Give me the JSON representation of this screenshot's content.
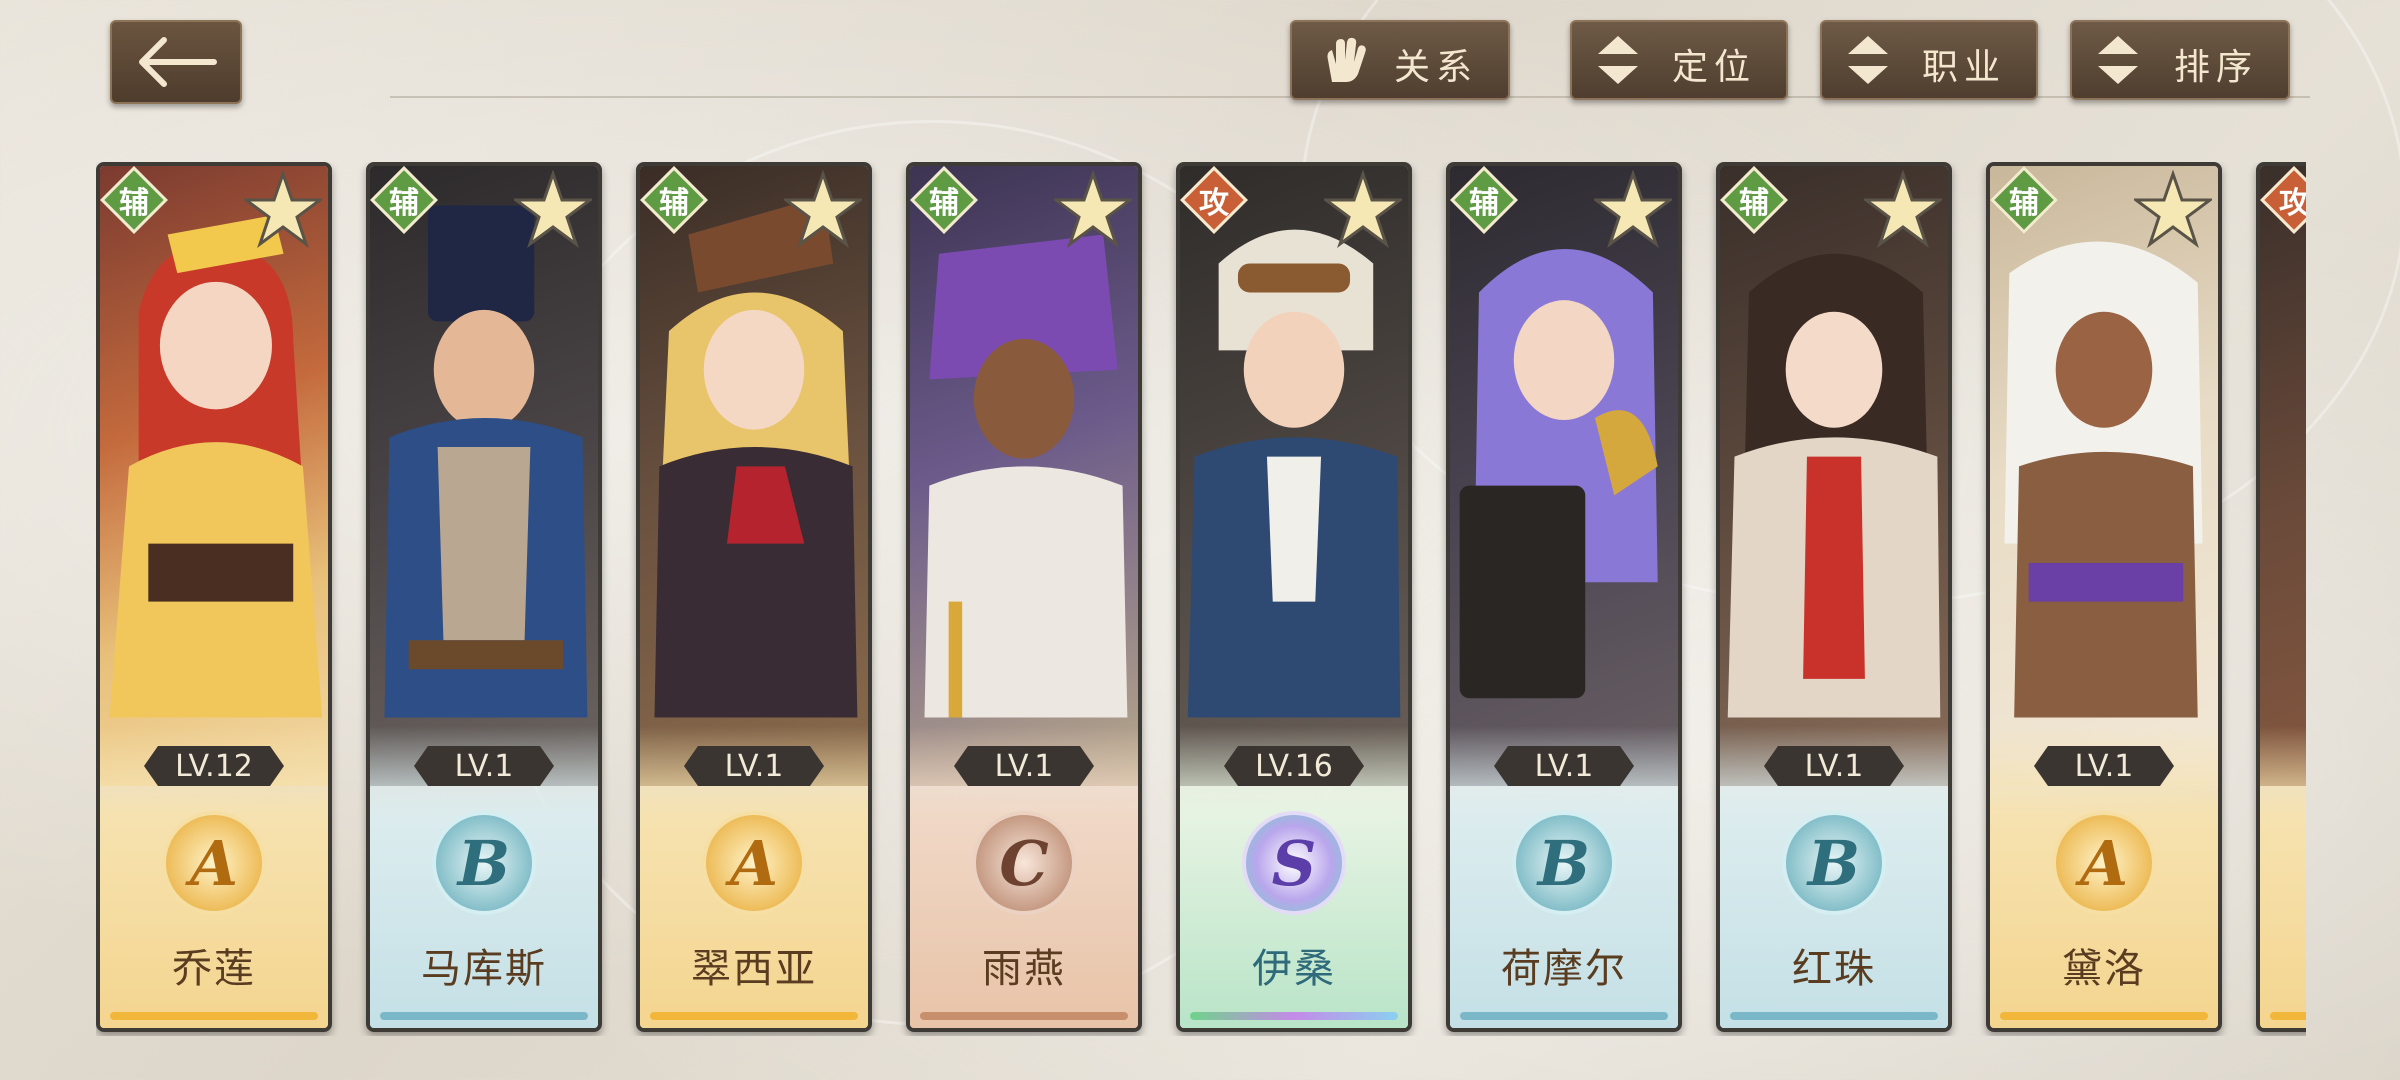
{
  "toolbar": {
    "relation_label": "关系",
    "position_label": "定位",
    "job_label": "职业",
    "sort_label": "排序"
  },
  "colors": {
    "support_tag": "#5f9b43",
    "attack_tag": "#c95f37",
    "rank_A": "#e6a52a",
    "rank_B": "#5aa7b5",
    "rank_C": "#b07a5e",
    "rank_S": "#8d6ad0"
  },
  "heroes": [
    {
      "role": "辅",
      "level": "LV.12",
      "rank": "A",
      "name": "乔莲"
    },
    {
      "role": "辅",
      "level": "LV.1",
      "rank": "B",
      "name": "马库斯"
    },
    {
      "role": "辅",
      "level": "LV.1",
      "rank": "A",
      "name": "翠西亚"
    },
    {
      "role": "辅",
      "level": "LV.1",
      "rank": "C",
      "name": "雨燕"
    },
    {
      "role": "攻",
      "level": "LV.16",
      "rank": "S",
      "name": "伊桑"
    },
    {
      "role": "辅",
      "level": "LV.1",
      "rank": "B",
      "name": "荷摩尔"
    },
    {
      "role": "辅",
      "level": "LV.1",
      "rank": "B",
      "name": "红珠"
    },
    {
      "role": "辅",
      "level": "LV.1",
      "rank": "A",
      "name": "黛洛"
    },
    {
      "role": "攻",
      "level": "",
      "rank": "",
      "name": ""
    }
  ]
}
